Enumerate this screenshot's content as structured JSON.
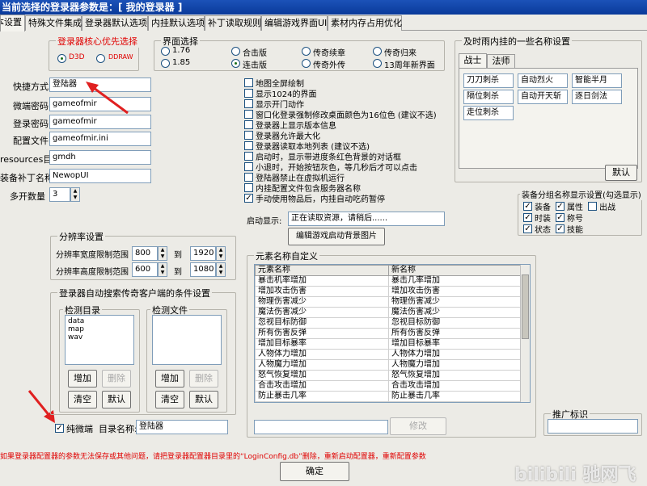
{
  "window": {
    "title": "当前选择的登录器参数是：[ 我的登录器 ]"
  },
  "tabs": [
    "基本设置",
    "特殊文件集成",
    "登录器默认选项",
    "内挂默认选项",
    "补丁读取规则",
    "编辑游戏界面UI",
    "素材内存占用优化"
  ],
  "core": {
    "title": "登录器核心优先选择",
    "opt1": "D3D",
    "opt2": "DDRAW"
  },
  "form": {
    "quick_label": "快捷方式",
    "quick_value": "登陆器",
    "micro_label": "微端密码",
    "micro_value": "gameofmir",
    "login_label": "登录密码",
    "login_value": "gameofmir",
    "config_label": "配置文件",
    "config_value": "gameofmir.ini",
    "resources_label": "resources目录:",
    "resources_value": "gmdh",
    "patch_label": "装备补丁名称",
    "patch_value": "NewopUI",
    "multi_label": "多开数量",
    "multi_value": "3"
  },
  "ui": {
    "title": "界面选择",
    "opts": [
      "1.76",
      "合击版",
      "传奇续章",
      "传奇归来",
      "1.85",
      "连击版",
      "传奇外传",
      "13周年新界面"
    ]
  },
  "checks": [
    "地图全屏绘制",
    "显示1024的界面",
    "显示开门动作",
    "窗口化登录强制修改桌面颜色为16位色 (建议不选)",
    "登录器上显示版本信息",
    "登录器允许最大化",
    "登录器读取本地列表 (建议不选)",
    "启动时，显示带进度条红色背景的对话框",
    "小退时，开始按钮灰色，等几秒后才可以点击",
    "登陆器禁止在虚拟机运行",
    "内挂配置文件包含服务器名称",
    "手动使用物品后，内挂自动吃药暂停"
  ],
  "startup": {
    "label": "启动显示:",
    "value": "正在读取资源，请稍后......",
    "button": "编辑游戏启动背景图片"
  },
  "skills": {
    "title": "及时雨内挂的一些名称设置",
    "tabs": [
      "战士",
      "法师"
    ],
    "items": [
      "刀刀刺杀",
      "自动烈火",
      "智能半月",
      "隔位刺杀",
      "自动开天斩",
      "逐日剑法",
      "走位刺杀"
    ],
    "default_button": "默认"
  },
  "equip": {
    "title": "装备分组名称显示设置(勾选显示)",
    "items": [
      "装备",
      "属性",
      "出战",
      "时装",
      "称号",
      "状态",
      "技能"
    ],
    "checked": [
      true,
      true,
      false,
      true,
      true,
      true,
      true
    ]
  },
  "resolution": {
    "title": "分辨率设置",
    "width_label": "分辨率宽度限制范围",
    "width_from": "800",
    "width_to": "1920",
    "height_label": "分辨率高度限制范围",
    "height_from": "600",
    "height_to": "1080",
    "to": "到"
  },
  "search": {
    "title": "登录器自动搜索传奇客户端的条件设置",
    "dir_label": "检测目录",
    "dirs": [
      "data",
      "map",
      "wav"
    ],
    "file_label": "检测文件",
    "add": "增加",
    "delete": "删除",
    "clear": "清空",
    "default": "默认",
    "micro_check": "纯微端",
    "dir_name_label": "目录名称:",
    "dir_name_value": "登陆器"
  },
  "elements": {
    "title": "元素名称自定义",
    "col1": "元素名称",
    "col2": "新名称",
    "rows": [
      [
        "暴击机率增加",
        "暴击几率增加"
      ],
      [
        "增加攻击伤害",
        "增加攻击伤害"
      ],
      [
        "物理伤害减少",
        "物理伤害减少"
      ],
      [
        "魔法伤害减少",
        "魔法伤害减少"
      ],
      [
        "忽视目标防御",
        "忽视目标防御"
      ],
      [
        "所有伤害反弹",
        "所有伤害反弹"
      ],
      [
        "增加目标暴率",
        "增加目标暴率"
      ],
      [
        "人物体力增加",
        "人物体力增加"
      ],
      [
        "人物魔力增加",
        "人物魔力增加"
      ],
      [
        "怒气恢复增加",
        "怒气恢复增加"
      ],
      [
        "合击攻击增加",
        "合击攻击增加"
      ],
      [
        "防止暴击几率",
        "防止暴击几率"
      ]
    ],
    "modify": "修改"
  },
  "promo": {
    "title": "推广标识"
  },
  "warning": "如果登录器配置器的参数无法保存或其他问题，请把登录器配置器目录里的“LoginConfig.db”删除，重新启动配置器，重新配置参数",
  "ok": "确定",
  "watermark": "bilibili 驰网飞"
}
